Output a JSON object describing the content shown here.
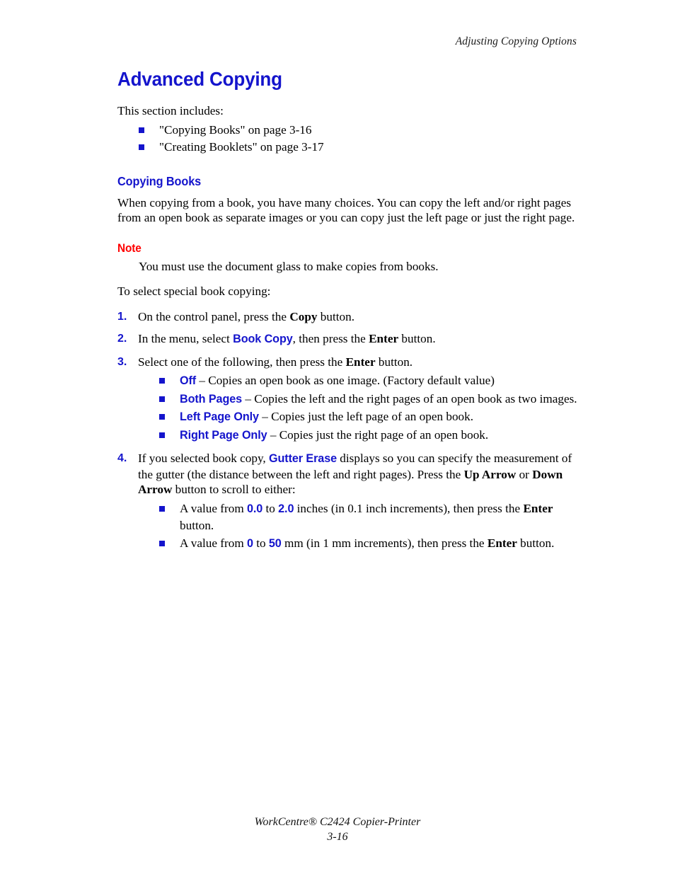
{
  "header": {
    "running_header": "Adjusting Copying Options"
  },
  "colors": {
    "heading_blue": "#1414CC",
    "note_red": "#FF0000",
    "body_black": "#000000",
    "page_background": "#FFFFFF"
  },
  "main": {
    "chapter_title": "Advanced Copying",
    "intro": "This section includes:",
    "toc_items": [
      "\"Copying Books\" on page 3-16",
      "\"Creating Booklets\" on page 3-17"
    ],
    "section": {
      "title": "Copying Books",
      "paragraph": "When copying from a book, you have many choices. You can copy the left and/or right pages from an open book as separate images or you can copy just the left page or just the right page.",
      "note": {
        "label": "Note",
        "text": "You must use the document glass to make copies from books."
      },
      "procedure_intro": "To select special book copying:",
      "steps": [
        {
          "number": "1.",
          "parts": [
            {
              "type": "text",
              "text": "On the control panel, press the "
            },
            {
              "type": "button",
              "text": "Copy"
            },
            {
              "type": "text",
              "text": " button."
            }
          ]
        },
        {
          "number": "2.",
          "parts": [
            {
              "type": "text",
              "text": "In the menu, select "
            },
            {
              "type": "ui",
              "text": "Book Copy"
            },
            {
              "type": "text",
              "text": ", then press the "
            },
            {
              "type": "button",
              "text": "Enter"
            },
            {
              "type": "text",
              "text": " button."
            }
          ]
        },
        {
          "number": "3.",
          "parts": [
            {
              "type": "text",
              "text": "Select one of the following, then press the "
            },
            {
              "type": "button",
              "text": "Enter"
            },
            {
              "type": "text",
              "text": " button."
            }
          ],
          "bullets": [
            {
              "term": "Off",
              "description": " – Copies an open book as one image. (Factory default value)"
            },
            {
              "term": "Both Pages",
              "description": " – Copies the left and the right pages of an open book as two images."
            },
            {
              "term": "Left Page Only",
              "description": " – Copies just the left page of an open book."
            },
            {
              "term": "Right Page Only",
              "description": " – Copies just the right page of an open book."
            }
          ]
        },
        {
          "number": "4.",
          "parts": [
            {
              "type": "text",
              "text": "If you selected book copy, "
            },
            {
              "type": "ui",
              "text": "Gutter Erase"
            },
            {
              "type": "text",
              "text": " displays so you can specify the measurement of the gutter (the distance between the left and right pages). Press the "
            },
            {
              "type": "button",
              "text": "Up Arrow"
            },
            {
              "type": "text",
              "text": " or "
            },
            {
              "type": "button",
              "text": "Down Arrow"
            },
            {
              "type": "text",
              "text": " button to scroll to either:"
            }
          ],
          "value_bullets": [
            {
              "parts": [
                {
                  "type": "text",
                  "text": "A value from "
                },
                {
                  "type": "ui",
                  "text": "0.0"
                },
                {
                  "type": "text",
                  "text": " to "
                },
                {
                  "type": "ui",
                  "text": "2.0"
                },
                {
                  "type": "text",
                  "text": " inches (in 0.1 inch increments), then press the "
                },
                {
                  "type": "button",
                  "text": "Enter"
                },
                {
                  "type": "text",
                  "text": " button."
                }
              ]
            },
            {
              "parts": [
                {
                  "type": "text",
                  "text": "A value from "
                },
                {
                  "type": "ui",
                  "text": "0"
                },
                {
                  "type": "text",
                  "text": " to "
                },
                {
                  "type": "ui",
                  "text": "50"
                },
                {
                  "type": "text",
                  "text": " mm (in 1 mm increments), then press the "
                },
                {
                  "type": "button",
                  "text": "Enter"
                },
                {
                  "type": "text",
                  "text": " button."
                }
              ]
            }
          ]
        }
      ]
    }
  },
  "footer": {
    "product": "WorkCentre® C2424 Copier-Printer",
    "page_number": "3-16"
  }
}
